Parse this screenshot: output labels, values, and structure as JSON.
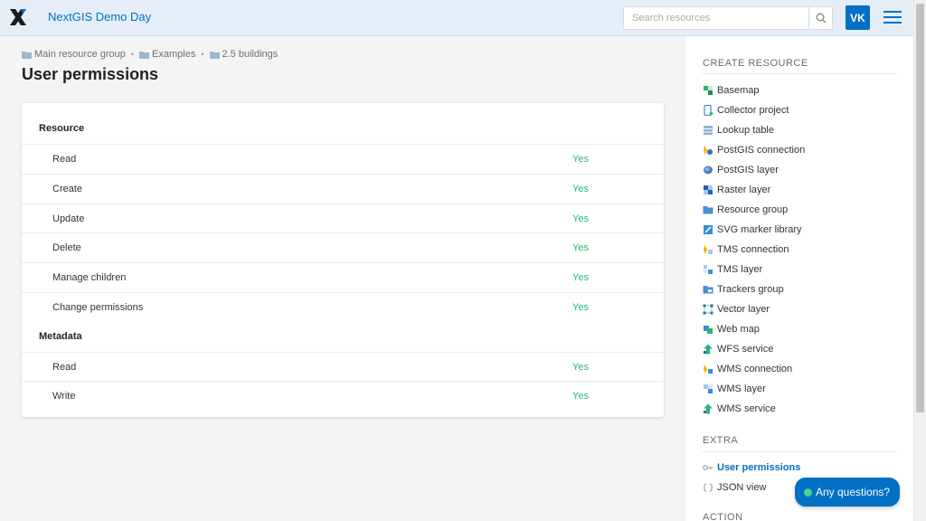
{
  "header": {
    "app_title": "NextGIS Demo Day",
    "search_placeholder": "Search resources",
    "avatar_initials": "VK"
  },
  "breadcrumb": [
    "Main resource group",
    "Examples",
    "2.5 buildings"
  ],
  "page_title": "User permissions",
  "permissions": {
    "yes_label": "Yes",
    "sections": [
      {
        "label": "Resource",
        "rows": [
          "Read",
          "Create",
          "Update",
          "Delete",
          "Manage children",
          "Change permissions"
        ]
      },
      {
        "label": "Metadata",
        "rows": [
          "Read",
          "Write"
        ]
      }
    ]
  },
  "sidebar": {
    "create_heading": "CREATE RESOURCE",
    "create_items": [
      {
        "label": "Basemap",
        "icon": "basemap-icon"
      },
      {
        "label": "Collector project",
        "icon": "collector-project-icon"
      },
      {
        "label": "Lookup table",
        "icon": "lookup-table-icon"
      },
      {
        "label": "PostGIS connection",
        "icon": "postgis-connection-icon"
      },
      {
        "label": "PostGIS layer",
        "icon": "postgis-layer-icon"
      },
      {
        "label": "Raster layer",
        "icon": "raster-layer-icon"
      },
      {
        "label": "Resource group",
        "icon": "folder-icon"
      },
      {
        "label": "SVG marker library",
        "icon": "svg-marker-library-icon"
      },
      {
        "label": "TMS connection",
        "icon": "tms-connection-icon"
      },
      {
        "label": "TMS layer",
        "icon": "tms-layer-icon"
      },
      {
        "label": "Trackers group",
        "icon": "trackers-group-icon"
      },
      {
        "label": "Vector layer",
        "icon": "vector-layer-icon"
      },
      {
        "label": "Web map",
        "icon": "web-map-icon"
      },
      {
        "label": "WFS service",
        "icon": "wfs-service-icon"
      },
      {
        "label": "WMS connection",
        "icon": "wms-connection-icon"
      },
      {
        "label": "WMS layer",
        "icon": "wms-layer-icon"
      },
      {
        "label": "WMS service",
        "icon": "wms-service-icon"
      }
    ],
    "extra_heading": "EXTRA",
    "extra_items": [
      {
        "label": "User permissions",
        "icon": "key-icon",
        "active": true
      },
      {
        "label": "JSON view",
        "icon": "braces-icon",
        "active": false
      }
    ],
    "action_heading": "ACTION"
  },
  "help_button": "Any questions?",
  "colors": {
    "accent": "#0070c5",
    "yes": "#2bb673",
    "header_bg": "#e5eef7"
  }
}
